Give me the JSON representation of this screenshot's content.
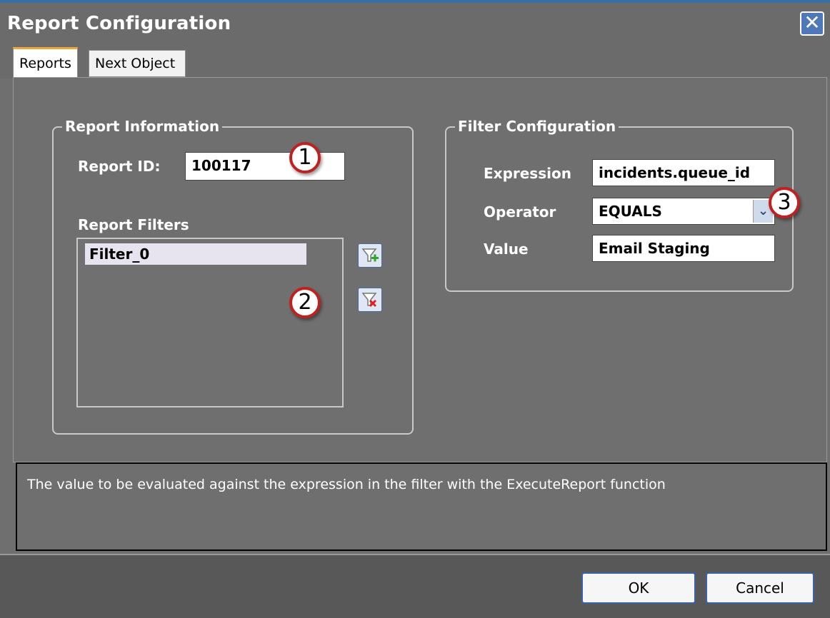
{
  "window": {
    "title": "Report Configuration",
    "close_icon": "close-icon"
  },
  "tabs": [
    {
      "label": "Reports",
      "active": true
    },
    {
      "label": "Next Object",
      "active": false
    }
  ],
  "report_information": {
    "title": "Report Information",
    "report_id_label": "Report ID:",
    "report_id_value": "100117",
    "filters_label": "Report Filters",
    "filters": [
      "Filter_0"
    ],
    "add_filter_icon": "funnel-add-icon",
    "remove_filter_icon": "funnel-remove-icon"
  },
  "filter_configuration": {
    "title": "Filter Configuration",
    "expression_label": "Expression",
    "expression_value": "incidents.queue_id",
    "operator_label": "Operator",
    "operator_value": "EQUALS",
    "value_label": "Value",
    "value_value": "Email Staging"
  },
  "callouts": [
    "1",
    "2",
    "3"
  ],
  "help_text": "The value to be evaluated against the expression in the filter with the ExecuteReport function",
  "buttons": {
    "ok": "OK",
    "cancel": "Cancel"
  },
  "colors": {
    "title_accent": "#3b6ea5",
    "tab_accent": "#f2a53b",
    "callout_border": "#c02020"
  }
}
